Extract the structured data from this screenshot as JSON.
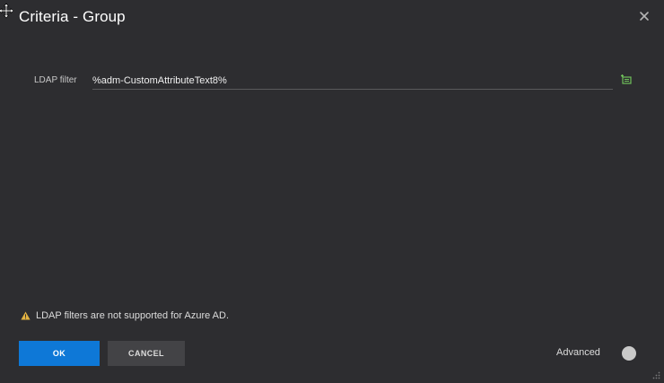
{
  "dialog": {
    "title": "Criteria - Group",
    "close_icon": "close-icon",
    "move_icon": "move-icon"
  },
  "ldap": {
    "label": "LDAP filter",
    "value": "%adm-CustomAttributeText8%",
    "insert_icon": "insert-variable-icon"
  },
  "warning": {
    "icon": "warning-icon",
    "text": "LDAP filters are not supported for Azure AD."
  },
  "footer": {
    "ok_label": "OK",
    "cancel_label": "CANCEL",
    "advanced_label": "Advanced",
    "advanced_on": false
  },
  "colors": {
    "background": "#2d2d30",
    "primary": "#0e78d7",
    "secondary_button": "#434346",
    "warning": "#e3b341",
    "insert_icon": "#6fbf5a"
  }
}
